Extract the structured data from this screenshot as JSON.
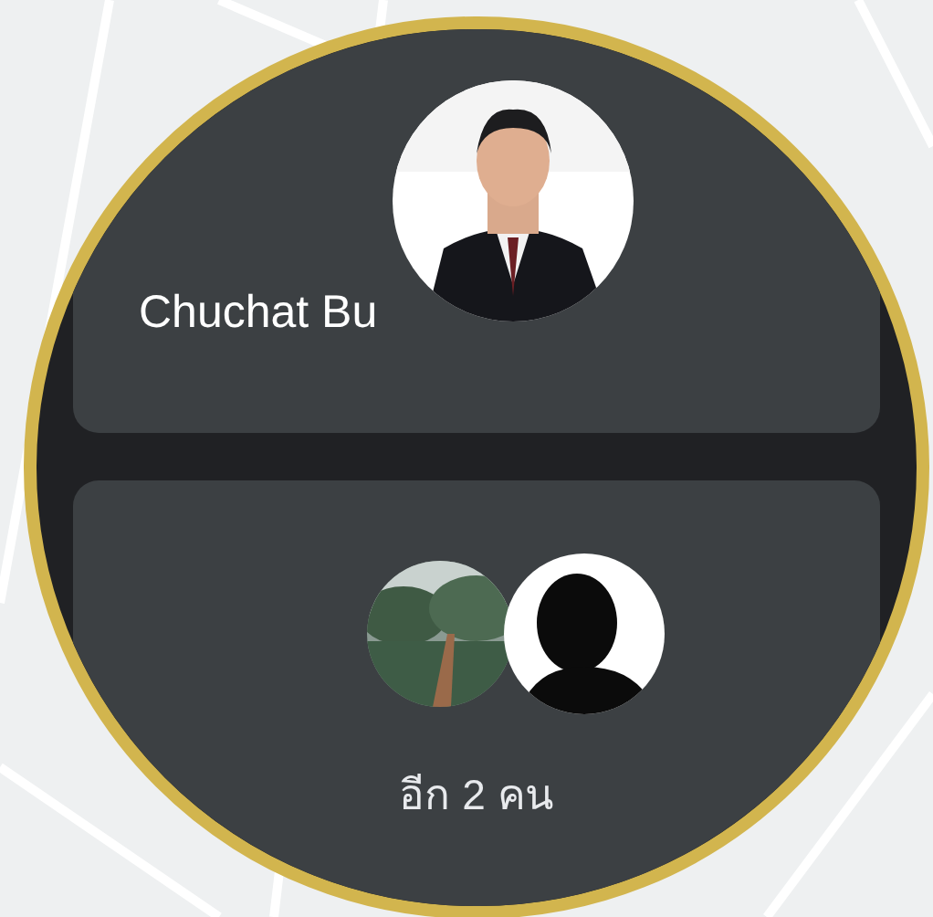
{
  "participant_tile": {
    "name": "Chuchat Bu"
  },
  "others_tile": {
    "label": "อีก 2 คน"
  }
}
